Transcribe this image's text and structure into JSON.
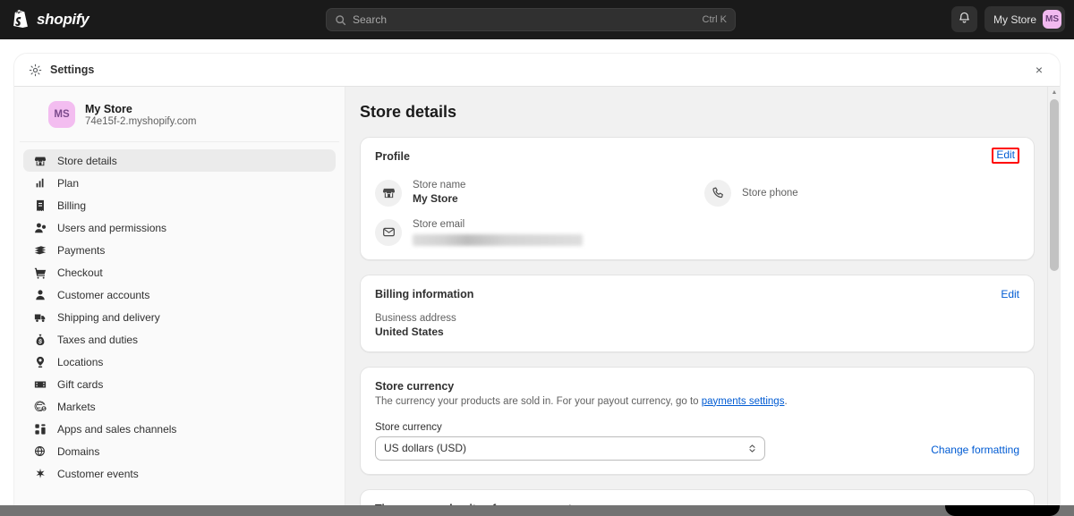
{
  "topbar": {
    "brand_name": "shopify",
    "brand_icon": "shopify-bag-logo",
    "search": {
      "icon": "search-icon",
      "placeholder": "Search",
      "shortcut": "Ctrl K"
    },
    "notifications_icon": "bell-icon",
    "store_menu_label": "My Store",
    "store_menu_initials": "MS"
  },
  "modal": {
    "icon": "gear-icon",
    "title": "Settings",
    "close_icon": "close-icon",
    "close_label": "×"
  },
  "sidebar": {
    "store_initials": "MS",
    "store_name": "My Store",
    "store_url": "74e15f-2.myshopify.com",
    "items": [
      {
        "label": "Store details",
        "icon": "store-icon",
        "active": true
      },
      {
        "label": "Plan",
        "icon": "chart-bar-icon",
        "active": false
      },
      {
        "label": "Billing",
        "icon": "receipt-icon",
        "active": false
      },
      {
        "label": "Users and permissions",
        "icon": "person-add-icon",
        "active": false
      },
      {
        "label": "Payments",
        "icon": "payment-card-icon",
        "active": false
      },
      {
        "label": "Checkout",
        "icon": "shopping-cart-icon",
        "active": false
      },
      {
        "label": "Customer accounts",
        "icon": "person-icon",
        "active": false
      },
      {
        "label": "Shipping and delivery",
        "icon": "truck-icon",
        "active": false
      },
      {
        "label": "Taxes and duties",
        "icon": "money-bag-icon",
        "active": false
      },
      {
        "label": "Locations",
        "icon": "location-pin-icon",
        "active": false
      },
      {
        "label": "Gift cards",
        "icon": "gift-card-icon",
        "active": false
      },
      {
        "label": "Markets",
        "icon": "globe-dollar-icon",
        "active": false
      },
      {
        "label": "Apps and sales channels",
        "icon": "apps-grid-icon",
        "active": false
      },
      {
        "label": "Domains",
        "icon": "globe-icon",
        "active": false
      },
      {
        "label": "Customer events",
        "icon": "sparkle-icon",
        "active": false
      }
    ]
  },
  "main": {
    "page_title": "Store details",
    "profile_card": {
      "title": "Profile",
      "edit_label": "Edit",
      "edit_highlight_color": "#ff0000",
      "store_name_label": "Store name",
      "store_name_value": "My Store",
      "store_name_icon": "store-icon",
      "store_email_label": "Store email",
      "store_email_value": "",
      "store_email_icon": "envelope-icon",
      "store_phone_label": "Store phone",
      "store_phone_value": "",
      "store_phone_icon": "phone-icon"
    },
    "billing_card": {
      "title": "Billing information",
      "edit_label": "Edit",
      "address_label": "Business address",
      "address_value": "United States"
    },
    "currency_card": {
      "title": "Store currency",
      "description_before": "The currency your products are sold in. For your payout currency, go to ",
      "description_link": "payments settings",
      "description_after": ".",
      "select_label": "Store currency",
      "select_value": "US dollars (USD)",
      "select_icon": "chevron-updown-icon",
      "change_formatting_label": "Change formatting"
    },
    "timezone_card": {
      "title": "Time zone and units of measurement"
    }
  },
  "scrollbar": {
    "up_icon": "chevron-up-icon",
    "down_icon": "chevron-down-icon"
  },
  "colors": {
    "topbar_bg": "#1a1a1a",
    "accent_link": "#005bd3",
    "highlight": "#ff0000",
    "avatar_bg": "#f2b9f0",
    "content_bg": "#f1f1f1"
  }
}
